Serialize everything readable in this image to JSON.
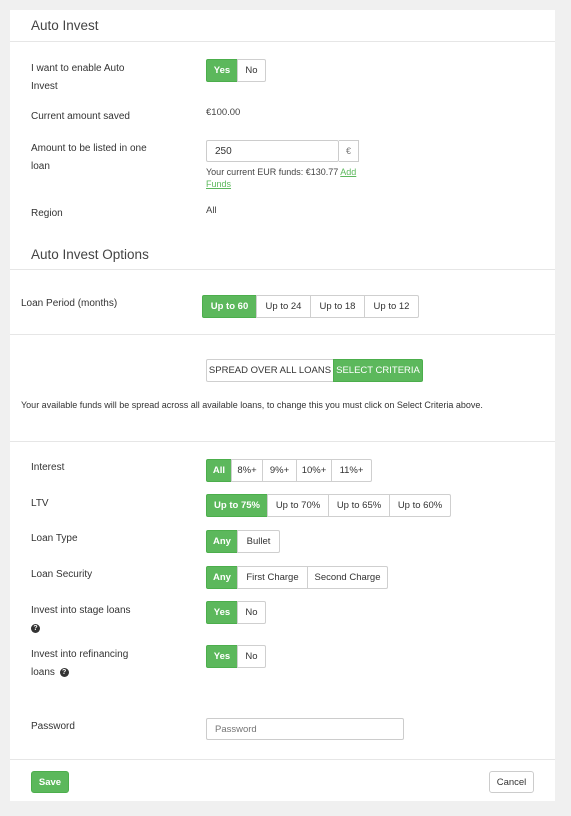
{
  "auto_invest": {
    "title": "Auto Invest",
    "enable": {
      "label": "I want to enable Auto Invest",
      "options": [
        "Yes",
        "No"
      ],
      "selected": "Yes"
    },
    "amount_saved": {
      "label": "Current amount saved",
      "value": "€100.00"
    },
    "amount_listed": {
      "label": "Amount to be listed in one loan",
      "value": "250",
      "addon": "€",
      "funds_text": "Your current EUR funds: €130.77",
      "add_funds_link": "Add Funds"
    },
    "region": {
      "label": "Region",
      "value": "All"
    }
  },
  "options": {
    "title": "Auto Invest Options",
    "loan_period": {
      "label": "Loan Period (months)",
      "options": [
        "Up to 60",
        "Up to 24",
        "Up to 18",
        "Up to 12"
      ],
      "selected": "Up to 60"
    },
    "spread": {
      "options": [
        "SPREAD OVER ALL LOANS",
        "SELECT CRITERIA"
      ],
      "selected": "SELECT CRITERIA"
    },
    "spread_note": "Your available funds will be spread across all available loans, to change this you must click on Select Criteria above.",
    "interest": {
      "label": "Interest",
      "options": [
        "All",
        "8%+",
        "9%+",
        "10%+",
        "11%+"
      ],
      "selected": "All"
    },
    "ltv": {
      "label": "LTV",
      "options": [
        "Up to 75%",
        "Up to 70%",
        "Up to 65%",
        "Up to 60%"
      ],
      "selected": "Up to 75%"
    },
    "loan_type": {
      "label": "Loan Type",
      "options": [
        "Any",
        "Bullet"
      ],
      "selected": "Any"
    },
    "loan_security": {
      "label": "Loan Security",
      "options": [
        "Any",
        "First Charge",
        "Second Charge"
      ],
      "selected": "Any"
    },
    "stage_loans": {
      "label": "Invest into stage loans",
      "options": [
        "Yes",
        "No"
      ],
      "selected": "Yes"
    },
    "refinancing_loans": {
      "label": "Invest into refinancing loans",
      "options": [
        "Yes",
        "No"
      ],
      "selected": "Yes"
    }
  },
  "password": {
    "label": "Password",
    "placeholder": "Password"
  },
  "actions": {
    "save": "Save",
    "cancel": "Cancel"
  },
  "colors": {
    "accent": "#5cb85c",
    "background": "#f0f0f0",
    "card": "#ffffff"
  },
  "icons": {
    "help": "question-circle-icon"
  }
}
